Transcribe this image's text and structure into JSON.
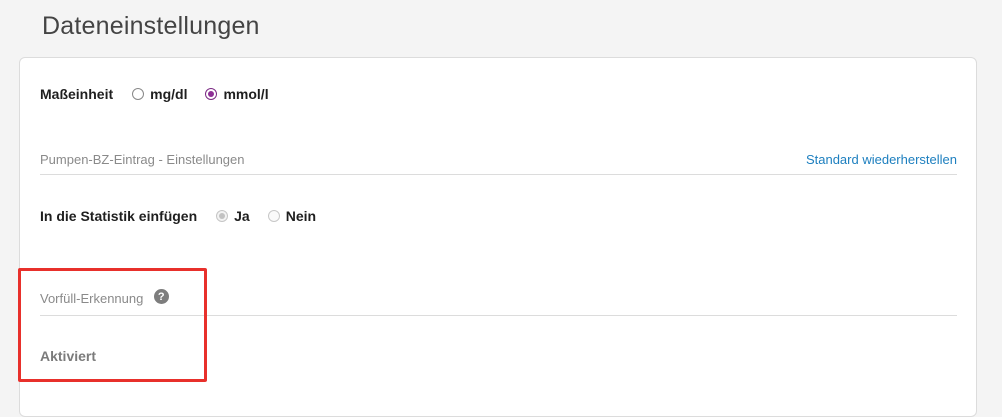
{
  "page": {
    "title": "Dateneinstellungen"
  },
  "units": {
    "label": "Maßeinheit",
    "options": [
      {
        "label": "mg/dl",
        "selected": false
      },
      {
        "label": "mmol/l",
        "selected": true
      }
    ]
  },
  "pump_entry": {
    "title": "Pumpen-BZ-Eintrag - Einstellungen",
    "reset_link": "Standard wiederherstellen",
    "statistics": {
      "label": "In die Statistik einfügen",
      "options": [
        {
          "label": "Ja",
          "selected": true
        },
        {
          "label": "Nein",
          "selected": false
        }
      ]
    }
  },
  "prime_detection": {
    "title": "Vorfüll-Erkennung",
    "help_icon": "question-circle-icon",
    "status": "Aktiviert"
  },
  "colors": {
    "accent": "#8e2f95",
    "link": "#1d7fbf",
    "highlight": "#e8302b"
  }
}
